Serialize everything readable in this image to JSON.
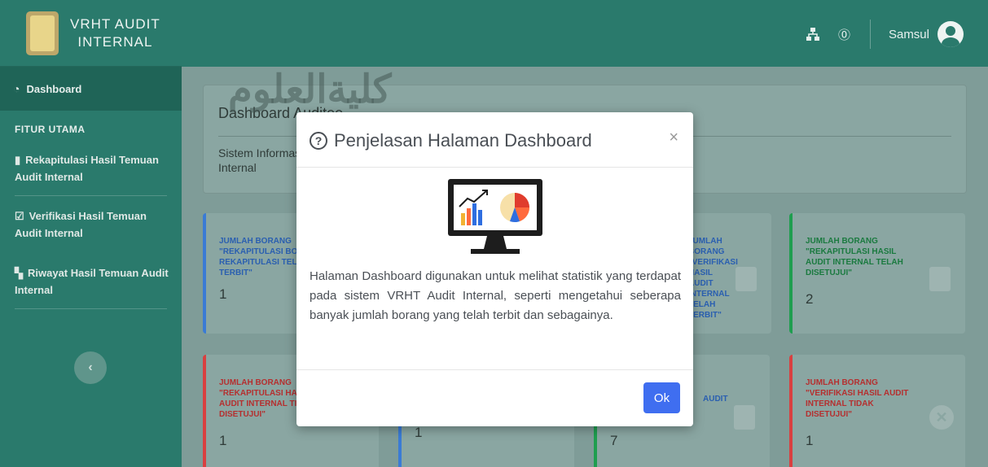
{
  "brand": {
    "line1": "VRHT AUDIT",
    "line2": "INTERNAL"
  },
  "sidebar": {
    "active": "Dashboard",
    "section": "FITUR UTAMA",
    "items": [
      {
        "label": "Rekapitulasi Hasil Temuan Audit Internal",
        "icon": "clipboard-icon"
      },
      {
        "label": "Verifikasi Hasil Temuan Audit Internal",
        "icon": "check-square-icon"
      },
      {
        "label": "Riwayat Hasil Temuan Audit Internal",
        "icon": "copy-icon"
      }
    ],
    "collapse": "‹"
  },
  "topbar": {
    "user": "Samsul"
  },
  "header": {
    "title": "Dashboard Auditee",
    "subtitle": "Sistem Informasi VRHT Audit Internal"
  },
  "watermark": "كليةالعلوم",
  "stats": [
    {
      "label": "JUMLAH BORANG \"REKAPITULASI BORANG REKAPITULASI TELAH TERBIT\"",
      "value": "1",
      "accent": "#3a7bd5"
    },
    {
      "label": "JUMLAH BORANG \"VERIFIKASI HASIL AUDIT INTERNAL TELAH TERBIT\"",
      "value": "",
      "accent": "#3a7bd5"
    },
    {
      "label": "JUMLAH BORANG \"VERIFIKASI HASIL AUDIT INTERNAL TELAH TERBIT\"",
      "value": "",
      "accent": "#3a7bd5"
    },
    {
      "label": "JUMLAH BORANG \"REKAPITULASI HASIL AUDIT INTERNAL TELAH DISETUJUI\"",
      "value": "2",
      "accent": "#1f9e4f"
    },
    {
      "label": "JUMLAH BORANG \"REKAPITULASI HASIL AUDIT INTERNAL TIDAK DISETUJUI\"",
      "value": "1",
      "accent": "#d94040"
    },
    {
      "label": "",
      "value": "1",
      "accent": "#3a7bd5"
    },
    {
      "label": "AUDIT",
      "value": "7",
      "accent": "#1f9e4f"
    },
    {
      "label": "JUMLAH BORANG \"VERIFIKASI HASIL AUDIT INTERNAL TIDAK DISETUJUI\"",
      "value": "1",
      "accent": "#d94040"
    }
  ],
  "modal": {
    "title": "Penjelasan Halaman Dashboard",
    "body": "Halaman Dashboard digunakan untuk melihat statistik yang terdapat pada sistem VRHT Audit Internal, seperti mengetahui seberapa banyak jumlah borang yang telah terbit dan sebagainya.",
    "ok": "Ok",
    "close": "×"
  }
}
